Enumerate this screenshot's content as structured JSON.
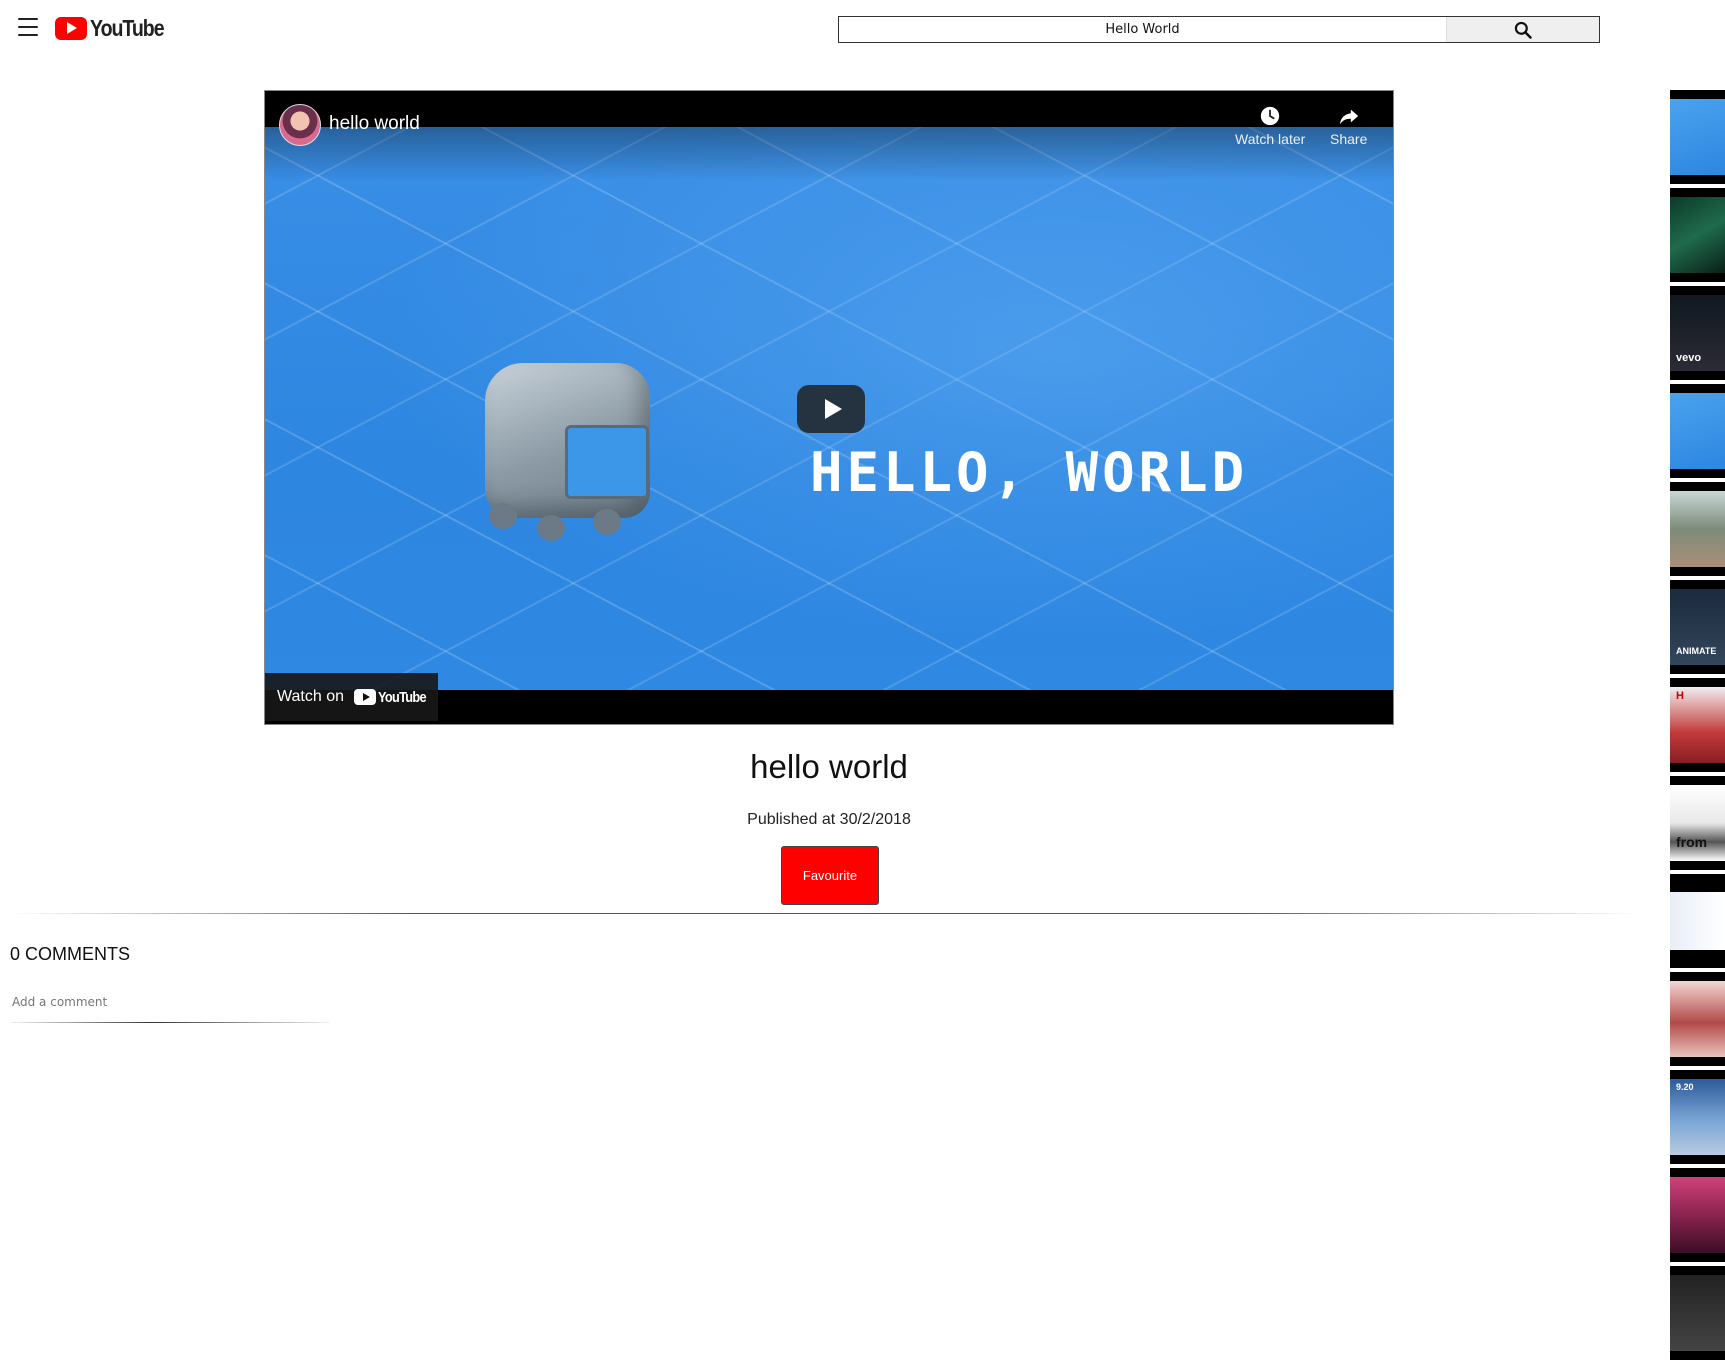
{
  "header": {
    "logo_text": "YouTube",
    "search_value": "Hello World"
  },
  "player": {
    "channel_title": "hello world",
    "watch_later_label": "Watch later",
    "share_label": "Share",
    "overlay_text": "HELLO, WORLD",
    "watch_on_label": "Watch on",
    "watch_on_logo_text": "YouTube"
  },
  "video": {
    "title": "hello world",
    "published": "Published at 30/2/2018",
    "favourite_label": "Favourite"
  },
  "comments": {
    "count_label": "0 COMMENTS",
    "placeholder": "Add a comment"
  },
  "sidebar": {
    "thumbnails": [
      {
        "caption": ""
      },
      {
        "caption": ""
      },
      {
        "caption": "vevo"
      },
      {
        "caption": ""
      },
      {
        "caption": ""
      },
      {
        "caption": "ANIMATE"
      },
      {
        "caption": "H"
      },
      {
        "caption": "from"
      },
      {
        "caption": ""
      },
      {
        "caption": ""
      },
      {
        "caption": "9.20"
      },
      {
        "caption": ""
      },
      {
        "caption": ""
      }
    ]
  },
  "colors": {
    "brand_red": "#ff0000",
    "video_blue": "#2d86e0"
  }
}
